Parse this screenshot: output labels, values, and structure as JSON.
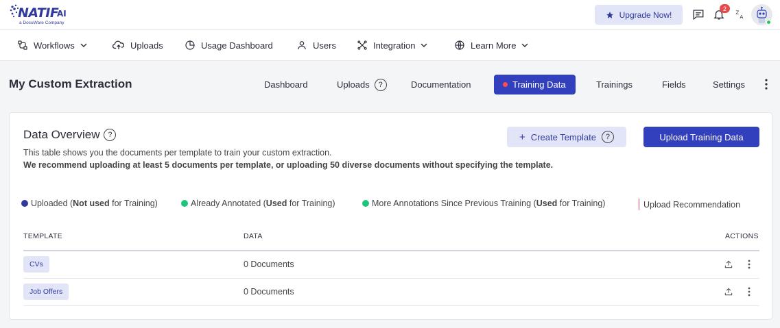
{
  "brand": {
    "name": "NATIF",
    "suffix": "AI",
    "tagline": "a DocuWare Company"
  },
  "topbar": {
    "upgrade_label": "Upgrade Now!",
    "notifications_count": "2"
  },
  "nav": [
    {
      "label": "Workflows",
      "icon": "workflow-icon",
      "dropdown": true
    },
    {
      "label": "Uploads",
      "icon": "cloud-upload-icon",
      "dropdown": false
    },
    {
      "label": "Usage Dashboard",
      "icon": "chart-pie-icon",
      "dropdown": false
    },
    {
      "label": "Users",
      "icon": "user-icon",
      "dropdown": false
    },
    {
      "label": "Integration",
      "icon": "integration-icon",
      "dropdown": true
    },
    {
      "label": "Learn More",
      "icon": "globe-icon",
      "dropdown": true
    }
  ],
  "page": {
    "title": "My Custom Extraction",
    "tabs": [
      {
        "label": "Dashboard"
      },
      {
        "label": "Uploads"
      },
      {
        "label": "Documentation"
      },
      {
        "label": "Training Data",
        "active": true
      },
      {
        "label": "Trainings"
      },
      {
        "label": "Fields"
      },
      {
        "label": "Settings"
      }
    ]
  },
  "overview": {
    "title": "Data Overview",
    "description": "This table shows you the documents per template to train your custom extraction.",
    "recommendation": "We recommend uploading at least 5 documents per template, or uploading 50 diverse documents without specifying the template.",
    "create_template_label": "Create Template",
    "upload_label": "Upload Training Data",
    "legend": {
      "uploaded": {
        "pre": "Uploaded (",
        "strong": "Not used",
        "post": " for Training)",
        "color": "#2f3a9c"
      },
      "annotated": {
        "pre": "Already Annotated (",
        "strong": "Used",
        "post": " for Training)",
        "color": "#1fc47a"
      },
      "more": {
        "pre": "More Annotations Since Previous Training (",
        "strong": "Used",
        "post": " for Training)",
        "color": "#1fc47a"
      },
      "recommendation": {
        "label": "Upload Recommendation",
        "color": "#e64a4a"
      }
    },
    "table": {
      "headers": {
        "template": "TEMPLATE",
        "data": "DATA",
        "actions": "ACTIONS"
      },
      "rows": [
        {
          "template": "CVs",
          "data": "0 Documents"
        },
        {
          "template": "Job Offers",
          "data": "0 Documents"
        }
      ]
    }
  },
  "colors": {
    "primary": "#3340bd",
    "primary_light": "#e2e5f7",
    "badge": "#e64a4a"
  }
}
